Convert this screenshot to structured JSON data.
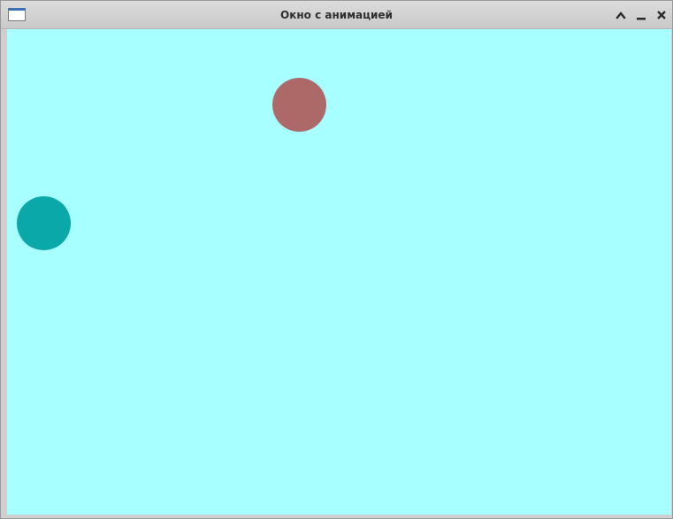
{
  "window": {
    "title": "Окно с анимацией",
    "icon": "window-icon",
    "buttons": [
      {
        "name": "maximize",
        "icon": "chevron-up-icon"
      },
      {
        "name": "minimize",
        "icon": "minimize-icon"
      },
      {
        "name": "close",
        "icon": "close-icon"
      }
    ]
  },
  "canvas": {
    "background": "#a8ffff",
    "balls": [
      {
        "name": "red-ball",
        "color": "#ad6868"
      },
      {
        "name": "teal-ball",
        "color": "#0aa8a8"
      }
    ]
  }
}
